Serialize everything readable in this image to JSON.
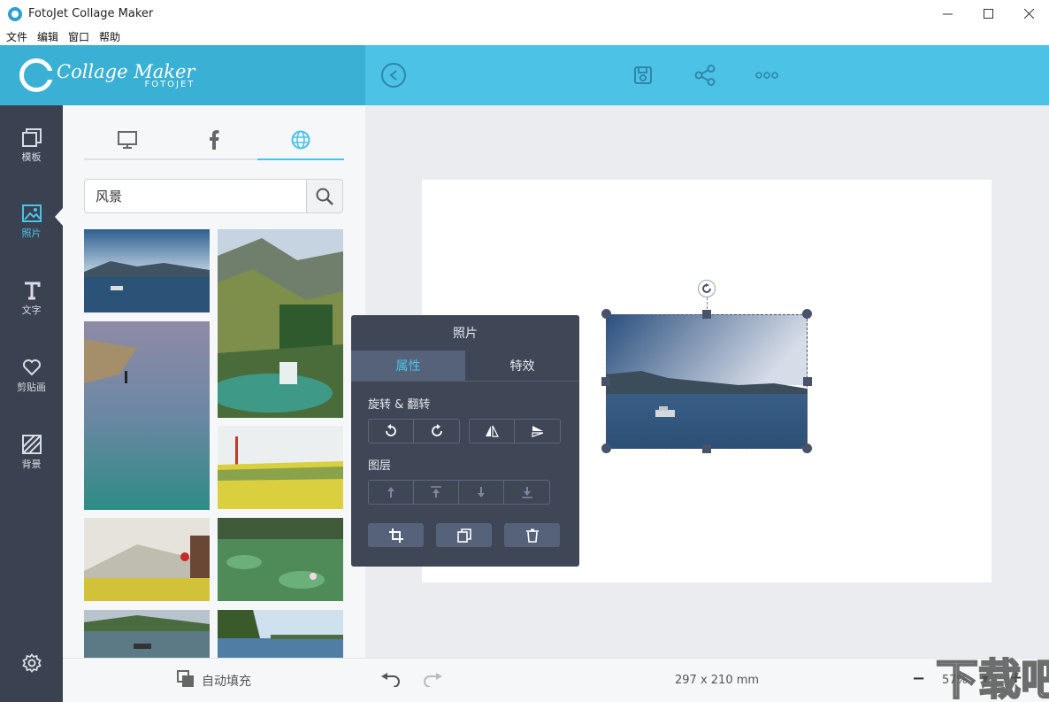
{
  "window": {
    "title": "FotoJet Collage Maker",
    "minimize_icon": "minimize-icon",
    "maximize_icon": "maximize-icon",
    "close_icon": "close-icon"
  },
  "menu": [
    "文件",
    "编辑",
    "窗口",
    "帮助"
  ],
  "brand": {
    "name": "Collage Maker",
    "sub": "FOTOJET"
  },
  "colors": {
    "header": "#4cc3e6",
    "brand": "#3ab0d4",
    "rail": "#3a4150",
    "accent": "#4cc3e6",
    "popup": "#3f4656"
  },
  "sidebar": {
    "items": [
      {
        "label": "模板",
        "icon": "template-icon"
      },
      {
        "label": "照片",
        "icon": "photo-icon",
        "active": true
      },
      {
        "label": "文字",
        "icon": "text-icon"
      },
      {
        "label": "剪贴画",
        "icon": "clipart-icon"
      },
      {
        "label": "背景",
        "icon": "background-icon"
      }
    ]
  },
  "photo_panel": {
    "source_tabs": [
      "computer-icon",
      "facebook-icon",
      "web-globe-icon"
    ],
    "active_source": "web-globe-icon",
    "search_value": "风景",
    "autofill_label": "自动填充"
  },
  "popup": {
    "title": "照片",
    "tabs": [
      "属性",
      "特效"
    ],
    "active_tab": "属性",
    "rotate_label": "旋转 & 翻转",
    "layer_label": "图层"
  },
  "footer": {
    "size": "297 x 210 mm",
    "zoom": "57%"
  }
}
